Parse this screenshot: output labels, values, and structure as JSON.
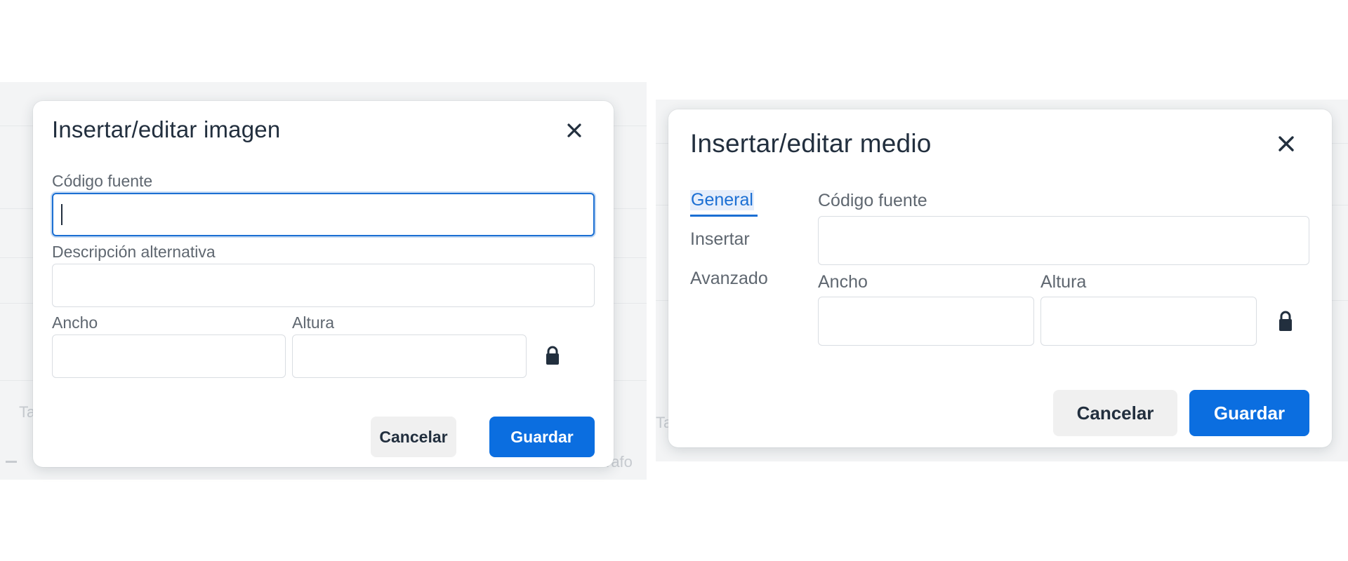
{
  "left_dialog": {
    "title": "Insertar/editar imagen",
    "fields": {
      "source_label": "Código fuente",
      "source_value": "",
      "alt_label": "Descripción alternativa",
      "alt_value": "",
      "width_label": "Ancho",
      "width_value": "",
      "height_label": "Altura",
      "height_value": ""
    },
    "buttons": {
      "cancel": "Cancelar",
      "save": "Guardar"
    },
    "icons": {
      "close": "close-icon",
      "lock": "lock-icon"
    }
  },
  "right_dialog": {
    "title": "Insertar/editar medio",
    "tabs": [
      {
        "label": "General",
        "active": true
      },
      {
        "label": "Insertar",
        "active": false
      },
      {
        "label": "Avanzado",
        "active": false
      }
    ],
    "fields": {
      "source_label": "Código fuente",
      "source_value": "",
      "width_label": "Ancho",
      "width_value": "",
      "height_label": "Altura",
      "height_value": ""
    },
    "buttons": {
      "cancel": "Cancelar",
      "save": "Guardar"
    },
    "icons": {
      "close": "close-icon",
      "lock": "lock-icon"
    }
  },
  "background": {
    "left_fragment_ta": "Ta",
    "left_fragment_rafo": "rafo",
    "right_fragment_ta": "Ta"
  },
  "colors": {
    "accent": "#1b6fd3",
    "primary_button": "#0b6ee0",
    "text": "#222f3e",
    "label": "#5f6770"
  }
}
